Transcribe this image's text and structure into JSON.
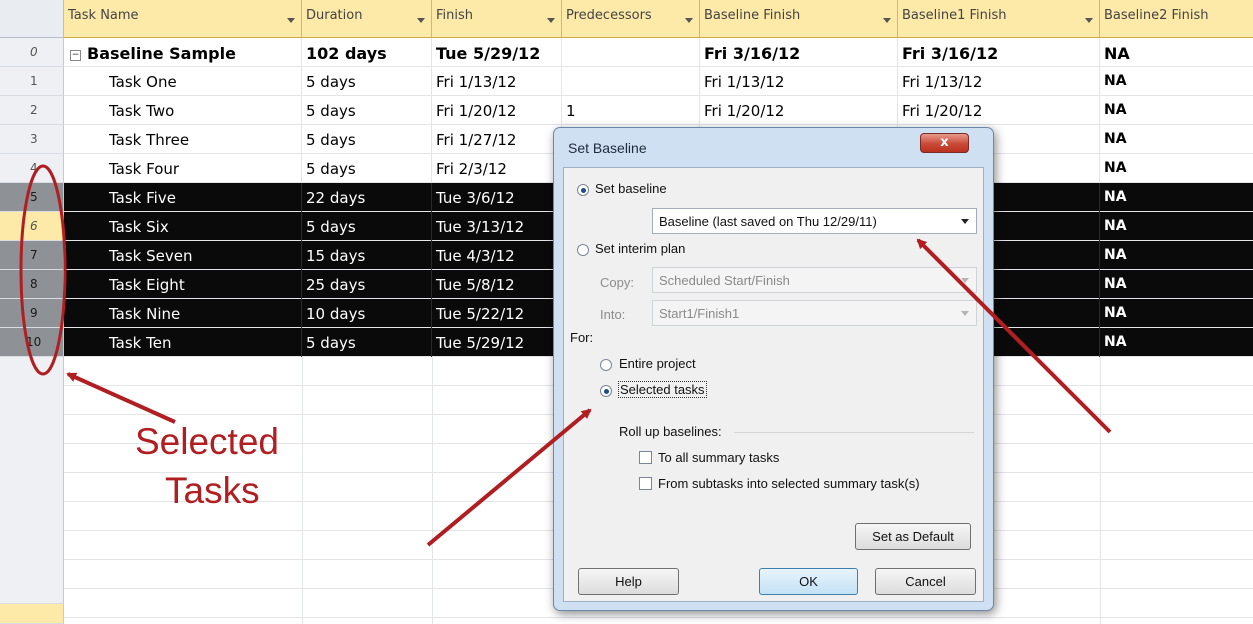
{
  "columns": [
    {
      "label": "Task Name"
    },
    {
      "label": "Duration"
    },
    {
      "label": "Finish"
    },
    {
      "label": "Predecessors"
    },
    {
      "label": "Baseline Finish"
    },
    {
      "label": "Baseline1 Finish"
    },
    {
      "label": "Baseline2 Finish"
    }
  ],
  "rows": [
    {
      "id": "0",
      "name": "Baseline Sample",
      "duration": "102 days",
      "finish": "Tue 5/29/12",
      "pred": "",
      "bfinish": "Fri 3/16/12",
      "b1finish": "Fri 3/16/12",
      "b2finish": "NA"
    },
    {
      "id": "1",
      "name": "Task One",
      "duration": "5 days",
      "finish": "Fri 1/13/12",
      "pred": "",
      "bfinish": "Fri 1/13/12",
      "b1finish": "Fri 1/13/12",
      "b2finish": "NA"
    },
    {
      "id": "2",
      "name": "Task Two",
      "duration": "5 days",
      "finish": "Fri 1/20/12",
      "pred": "1",
      "bfinish": "Fri 1/20/12",
      "b1finish": "Fri 1/20/12",
      "b2finish": "NA"
    },
    {
      "id": "3",
      "name": "Task Three",
      "duration": "5 days",
      "finish": "Fri 1/27/12",
      "pred": "",
      "bfinish": "",
      "b1finish": "",
      "b2finish": "NA"
    },
    {
      "id": "4",
      "name": "Task Four",
      "duration": "5 days",
      "finish": "Fri 2/3/12",
      "pred": "",
      "bfinish": "",
      "b1finish": "",
      "b2finish": "NA"
    },
    {
      "id": "5",
      "name": "Task Five",
      "duration": "22 days",
      "finish": "Tue 3/6/12",
      "pred": "",
      "bfinish": "",
      "b1finish": "",
      "b2finish": "NA"
    },
    {
      "id": "6",
      "name": "Task Six",
      "duration": "5 days",
      "finish": "Tue 3/13/12",
      "pred": "",
      "bfinish": "",
      "b1finish": "",
      "b2finish": "NA"
    },
    {
      "id": "7",
      "name": "Task Seven",
      "duration": "15 days",
      "finish": "Tue 4/3/12",
      "pred": "",
      "bfinish": "",
      "b1finish": "",
      "b2finish": "NA"
    },
    {
      "id": "8",
      "name": "Task Eight",
      "duration": "25 days",
      "finish": "Tue 5/8/12",
      "pred": "",
      "bfinish": "",
      "b1finish": "",
      "b2finish": "NA"
    },
    {
      "id": "9",
      "name": "Task Nine",
      "duration": "10 days",
      "finish": "Tue 5/22/12",
      "pred": "",
      "bfinish": "",
      "b1finish": "",
      "b2finish": "NA"
    },
    {
      "id": "10",
      "name": "Task Ten",
      "duration": "5 days",
      "finish": "Tue 5/29/12",
      "pred": "",
      "bfinish": "",
      "b1finish": "",
      "b2finish": "NA"
    }
  ],
  "annotation": {
    "line1": "Selected",
    "line2": "Tasks"
  },
  "dialog": {
    "title": "Set Baseline",
    "close_label": "x",
    "set_baseline_label": "Set baseline",
    "baseline_value": "Baseline (last saved on Thu 12/29/11)",
    "interim_label": "Set interim plan",
    "copy_label": "Copy:",
    "copy_value": "Scheduled Start/Finish",
    "into_label": "Into:",
    "into_value": "Start1/Finish1",
    "for_label": "For:",
    "entire_label": "Entire project",
    "selected_label": "Selected tasks",
    "rollup_label": "Roll up baselines:",
    "to_all_label": "To all summary tasks",
    "from_sub_label": "From subtasks into selected summary task(s)",
    "set_default_label": "Set as Default",
    "help_label": "Help",
    "ok_label": "OK",
    "cancel_label": "Cancel"
  }
}
